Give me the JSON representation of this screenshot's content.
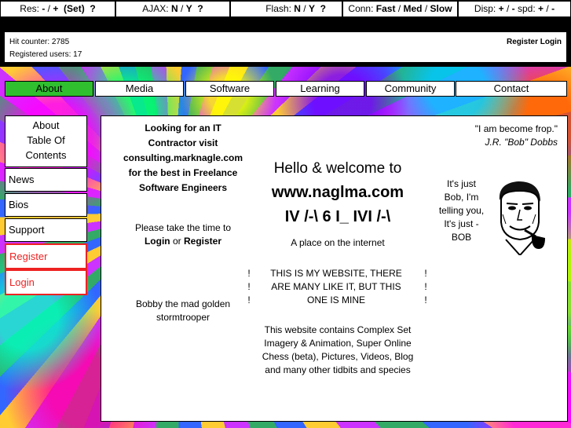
{
  "topbar": {
    "res": {
      "label": "Res:",
      "minus": "-",
      "sep": "/",
      "plus": "+",
      "set": "(Set)",
      "help": "?"
    },
    "ajax": {
      "label": "AJAX:",
      "n": "N",
      "sep": "/",
      "y": "Y",
      "help": "?"
    },
    "flash": {
      "label": "Flash:",
      "n": "N",
      "sep": "/",
      "y": "Y",
      "help": "?"
    },
    "conn": {
      "label": "Conn:",
      "fast": "Fast",
      "sep1": "/",
      "med": "Med",
      "sep2": "/",
      "slow": "Slow"
    },
    "disp": {
      "label": "Disp:",
      "plus": "+",
      "sep1": "/",
      "minus": "-",
      "spd": "spd:",
      "plus2": "+",
      "sep2": "/",
      "minus2": "-"
    }
  },
  "counter": {
    "hits": "Hit counter: 2785",
    "users": "Registered users: 17",
    "register": "Register",
    "login": "Login"
  },
  "nav": [
    "About",
    "Media",
    "Software",
    "Learning",
    "Community",
    "Contact"
  ],
  "sidebar": {
    "about_toc": [
      "About",
      "Table Of",
      "Contents"
    ],
    "news": "News",
    "bios": "Bios",
    "support": "Support",
    "register": "Register",
    "login": "Login"
  },
  "main": {
    "contractor": [
      "Looking for an IT",
      "Contractor visit",
      "consulting.marknagle.com",
      "for the best in Freelance",
      "Software Engineers"
    ],
    "please": "Please take the time to",
    "login": "Login",
    "or": "or",
    "register": "Register",
    "bobby": [
      "Bobby the mad golden",
      "stormtrooper"
    ],
    "hello": "Hello & welcome to",
    "site": "www.naglma.com",
    "ascii": "IV /-\\ 6 I_ IVI /-\\",
    "tagline": "A place on the internet",
    "bang": "!",
    "mine": [
      "THIS IS MY WEBSITE, THERE",
      "ARE MANY LIKE IT, BUT THIS",
      "ONE IS MINE"
    ],
    "contains": [
      "This website contains Complex Set",
      "Imagery & Animation, Super Online",
      "Chess (beta), Pictures, Videos, Blog",
      "and many other tidbits and species"
    ],
    "quote": "\"I am become frop.\"",
    "quote_author": "J.R. \"Bob\" Dobbs",
    "bob_text": [
      "It's just",
      "Bob, I'm",
      "telling you,",
      "It's just -",
      "BOB"
    ]
  }
}
